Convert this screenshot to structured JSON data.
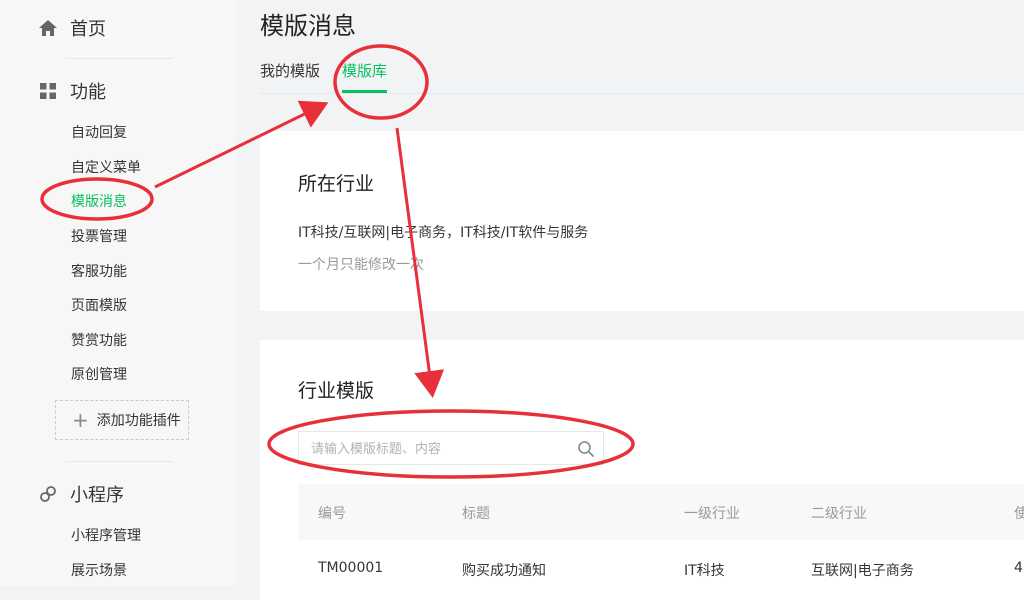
{
  "sidebar": {
    "home": {
      "label": "首页",
      "icon": "home-icon"
    },
    "features": {
      "label": "功能",
      "icon": "grid-icon",
      "items": [
        "自动回复",
        "自定义菜单",
        "模版消息",
        "投票管理",
        "客服功能",
        "页面模版",
        "赞赏功能",
        "原创管理"
      ],
      "active_index": 2
    },
    "add_plugin": {
      "label": "添加功能插件",
      "icon": "plus-icon"
    },
    "miniprogram": {
      "label": "小程序",
      "icon": "link-icon",
      "items": [
        "小程序管理",
        "展示场景"
      ]
    }
  },
  "main": {
    "title": "模版消息",
    "tabs": [
      {
        "label": "我的模版"
      },
      {
        "label": "模版库",
        "active": true
      }
    ],
    "industry_card": {
      "title": "所在行业",
      "industry": "IT科技/互联网|电子商务，IT科技/IT软件与服务",
      "note": "一个月只能修改一次"
    },
    "templates_card": {
      "title": "行业模版",
      "search": {
        "placeholder": "请输入模版标题、内容",
        "value": "",
        "icon": "search-icon"
      },
      "columns": [
        "编号",
        "标题",
        "一级行业",
        "二级行业",
        "使"
      ],
      "rows": [
        [
          "TM00001",
          "购买成功通知",
          "IT科技",
          "互联网|电子商务",
          "4"
        ]
      ]
    }
  },
  "colors": {
    "accent": "#07c160",
    "annotation": "#e8303a",
    "sidebar_bg": "#f7f7f7",
    "page_bg": "#f2f3f5"
  }
}
